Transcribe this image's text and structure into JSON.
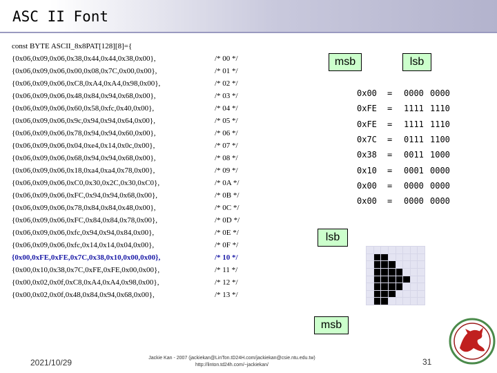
{
  "title": "ASC II Font",
  "code": {
    "header": "const BYTE ASCII_8x8PAT[128][8]={",
    "rows": [
      {
        "values": "{0x06,0x09,0x06,0x38,0x44,0x44,0x38,0x00},",
        "comment": "/* 00 */",
        "highlight": false
      },
      {
        "values": "{0x06,0x09,0x06,0x00,0x08,0x7C,0x00,0x00},",
        "comment": "/* 01 */",
        "highlight": false
      },
      {
        "values": "{0x06,0x09,0x06,0xC8,0xA4,0xA4,0x98,0x00},",
        "comment": "/* 02 */",
        "highlight": false
      },
      {
        "values": "{0x06,0x09,0x06,0x48,0x84,0x94,0x68,0x00},",
        "comment": "/* 03 */",
        "highlight": false
      },
      {
        "values": "{0x06,0x09,0x06,0x60,0x58,0xfc,0x40,0x00},",
        "comment": "/* 04 */",
        "highlight": false
      },
      {
        "values": "{0x06,0x09,0x06,0x9c,0x94,0x94,0x64,0x00},",
        "comment": "/* 05 */",
        "highlight": false
      },
      {
        "values": "{0x06,0x09,0x06,0x78,0x94,0x94,0x60,0x00},",
        "comment": "/* 06 */",
        "highlight": false
      },
      {
        "values": "{0x06,0x09,0x06,0x04,0xe4,0x14,0x0c,0x00},",
        "comment": "/* 07 */",
        "highlight": false
      },
      {
        "values": "{0x06,0x09,0x06,0x68,0x94,0x94,0x68,0x00},",
        "comment": "/* 08 */",
        "highlight": false
      },
      {
        "values": "{0x06,0x09,0x06,0x18,0xa4,0xa4,0x78,0x00},",
        "comment": "/* 09 */",
        "highlight": false
      },
      {
        "values": "{0x06,0x09,0x06,0xC0,0x30,0x2C,0x30,0xC0},",
        "comment": "/* 0A */",
        "highlight": false
      },
      {
        "values": "{0x06,0x09,0x06,0xFC,0x94,0x94,0x68,0x00},",
        "comment": "/* 0B */",
        "highlight": false
      },
      {
        "values": "{0x06,0x09,0x06,0x78,0x84,0x84,0x48,0x00},",
        "comment": "/* 0C */",
        "highlight": false
      },
      {
        "values": "{0x06,0x09,0x06,0xFC,0x84,0x84,0x78,0x00},",
        "comment": "/* 0D */",
        "highlight": false
      },
      {
        "values": "{0x06,0x09,0x06,0xfc,0x94,0x94,0x84,0x00},",
        "comment": "/* 0E */",
        "highlight": false
      },
      {
        "values": "{0x06,0x09,0x06,0xfc,0x14,0x14,0x04,0x00},",
        "comment": "/* 0F */",
        "highlight": false
      },
      {
        "values": "{0x00,0xFE,0xFE,0x7C,0x38,0x10,0x00,0x00},",
        "comment": "/* 10 */",
        "highlight": true
      },
      {
        "values": "{0x00,0x10,0x38,0x7C,0xFE,0xFE,0x00,0x00},",
        "comment": "/* 11 */",
        "highlight": false
      },
      {
        "values": "{0x00,0x02,0x0f,0xC8,0xA4,0xA4,0x98,0x00},",
        "comment": "/* 12 */",
        "highlight": false
      },
      {
        "values": "{0x00,0x02,0x0f,0x48,0x84,0x94,0x68,0x00},",
        "comment": "/* 13 */",
        "highlight": false
      }
    ]
  },
  "labels": {
    "msb_top": "msb",
    "lsb_top": "lsb",
    "lsb_side": "lsb",
    "msb_bottom": "msb"
  },
  "binary_rows": [
    {
      "hex": "0x00",
      "eq": "=",
      "hi": "0000",
      "lo": "0000"
    },
    {
      "hex": "0xFE",
      "eq": "=",
      "hi": "1111",
      "lo": "1110"
    },
    {
      "hex": "0xFE",
      "eq": "=",
      "hi": "1111",
      "lo": "1110"
    },
    {
      "hex": "0x7C",
      "eq": "=",
      "hi": "0111",
      "lo": "1100"
    },
    {
      "hex": "0x38",
      "eq": "=",
      "hi": "0011",
      "lo": "1000"
    },
    {
      "hex": "0x10",
      "eq": "=",
      "hi": "0001",
      "lo": "0000"
    },
    {
      "hex": "0x00",
      "eq": "=",
      "hi": "0000",
      "lo": "0000"
    },
    {
      "hex": "0x00",
      "eq": "=",
      "hi": "0000",
      "lo": "0000"
    }
  ],
  "glyph_bytes": [
    0,
    254,
    254,
    124,
    56,
    16,
    0,
    0
  ],
  "footer": {
    "date": "2021/10/29",
    "credit_line1": "Jackie Kan - 2007 (jackiekan@LinTon.tD24H.com/jackiekan@csie.ntu.edu.tw)",
    "credit_line2": "http://linton.td24h.com/~jackiekan/",
    "page": "31"
  },
  "colors": {
    "label_bg": "#ccffcc",
    "highlight_text": "#1a1aa6",
    "title_gradient_end": "#b3b3cd"
  }
}
